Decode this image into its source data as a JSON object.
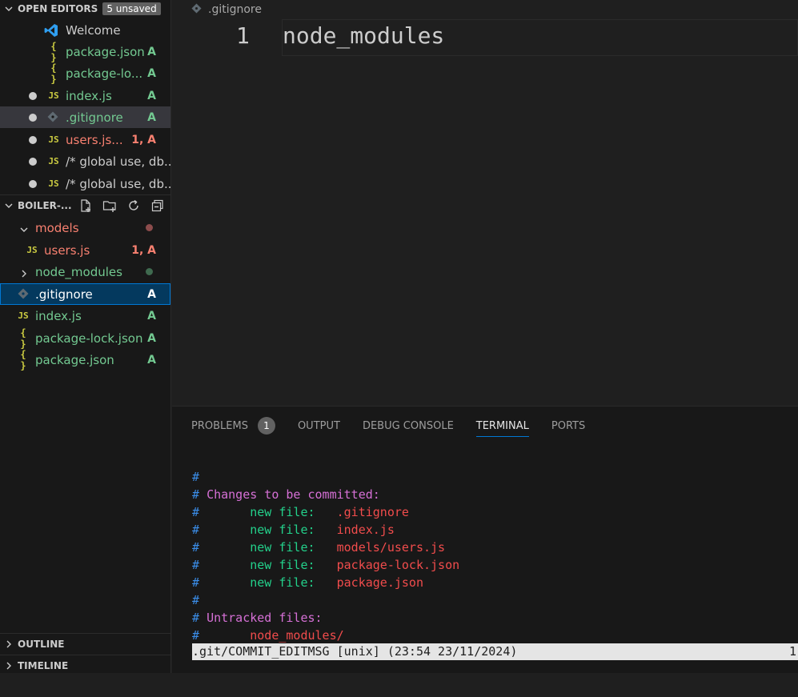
{
  "open_editors": {
    "title": "OPEN EDITORS",
    "badge": "5 unsaved",
    "items": [
      {
        "name": "Welcome",
        "icon": "vscode-icon",
        "status": "",
        "dot": false
      },
      {
        "name": "package.json",
        "icon": "{ }",
        "status": "A",
        "dot": false
      },
      {
        "name": "package-lo...",
        "icon": "{ }",
        "status": "A",
        "dot": false
      },
      {
        "name": "index.js",
        "icon": "JS",
        "status": "A",
        "dot": true
      },
      {
        "name": ".gitignore",
        "icon": "git-file-icon",
        "status": "A",
        "dot": true
      },
      {
        "name": "users.js...",
        "icon": "JS",
        "status": "1, A",
        "dot": true
      },
      {
        "name": "/* global use, db...",
        "icon": "JS",
        "status": "",
        "dot": true
      },
      {
        "name": "/* global use, db...",
        "icon": "JS",
        "status": "",
        "dot": true
      }
    ]
  },
  "explorer": {
    "title": "BOILER-...",
    "items": [
      {
        "name": "models",
        "icon": "",
        "status": ""
      },
      {
        "name": "users.js",
        "icon": "JS",
        "status": "1, A"
      },
      {
        "name": "node_modules",
        "icon": "",
        "status": ""
      },
      {
        "name": ".gitignore",
        "icon": "git-file-icon",
        "status": "A"
      },
      {
        "name": "index.js",
        "icon": "JS",
        "status": "A"
      },
      {
        "name": "package-lock.json",
        "icon": "{ }",
        "status": "A"
      },
      {
        "name": "package.json",
        "icon": "{ }",
        "status": "A"
      }
    ]
  },
  "outline": {
    "title": "OUTLINE"
  },
  "timeline": {
    "title": "TIMELINE"
  },
  "editor": {
    "breadcrumb": ".gitignore",
    "line_number": "1",
    "line_text": "node_modules"
  },
  "panel": {
    "tabs": [
      "PROBLEMS",
      "OUTPUT",
      "DEBUG CONSOLE",
      "TERMINAL",
      "PORTS"
    ],
    "problems_count": "1",
    "terminal": {
      "hash": "#",
      "changes_header": "Changes to be committed:",
      "new_file_label": "new file:",
      "committed_files": [
        ".gitignore",
        "index.js",
        "models/users.js",
        "package-lock.json",
        "package.json"
      ],
      "untracked_header": "Untracked files:",
      "untracked_files": [
        "node_modules/"
      ],
      "status_bar_text": ".git/COMMIT_EDITMSG [unix] (23:54 23/11/2024)",
      "status_bar_right": "1"
    }
  }
}
